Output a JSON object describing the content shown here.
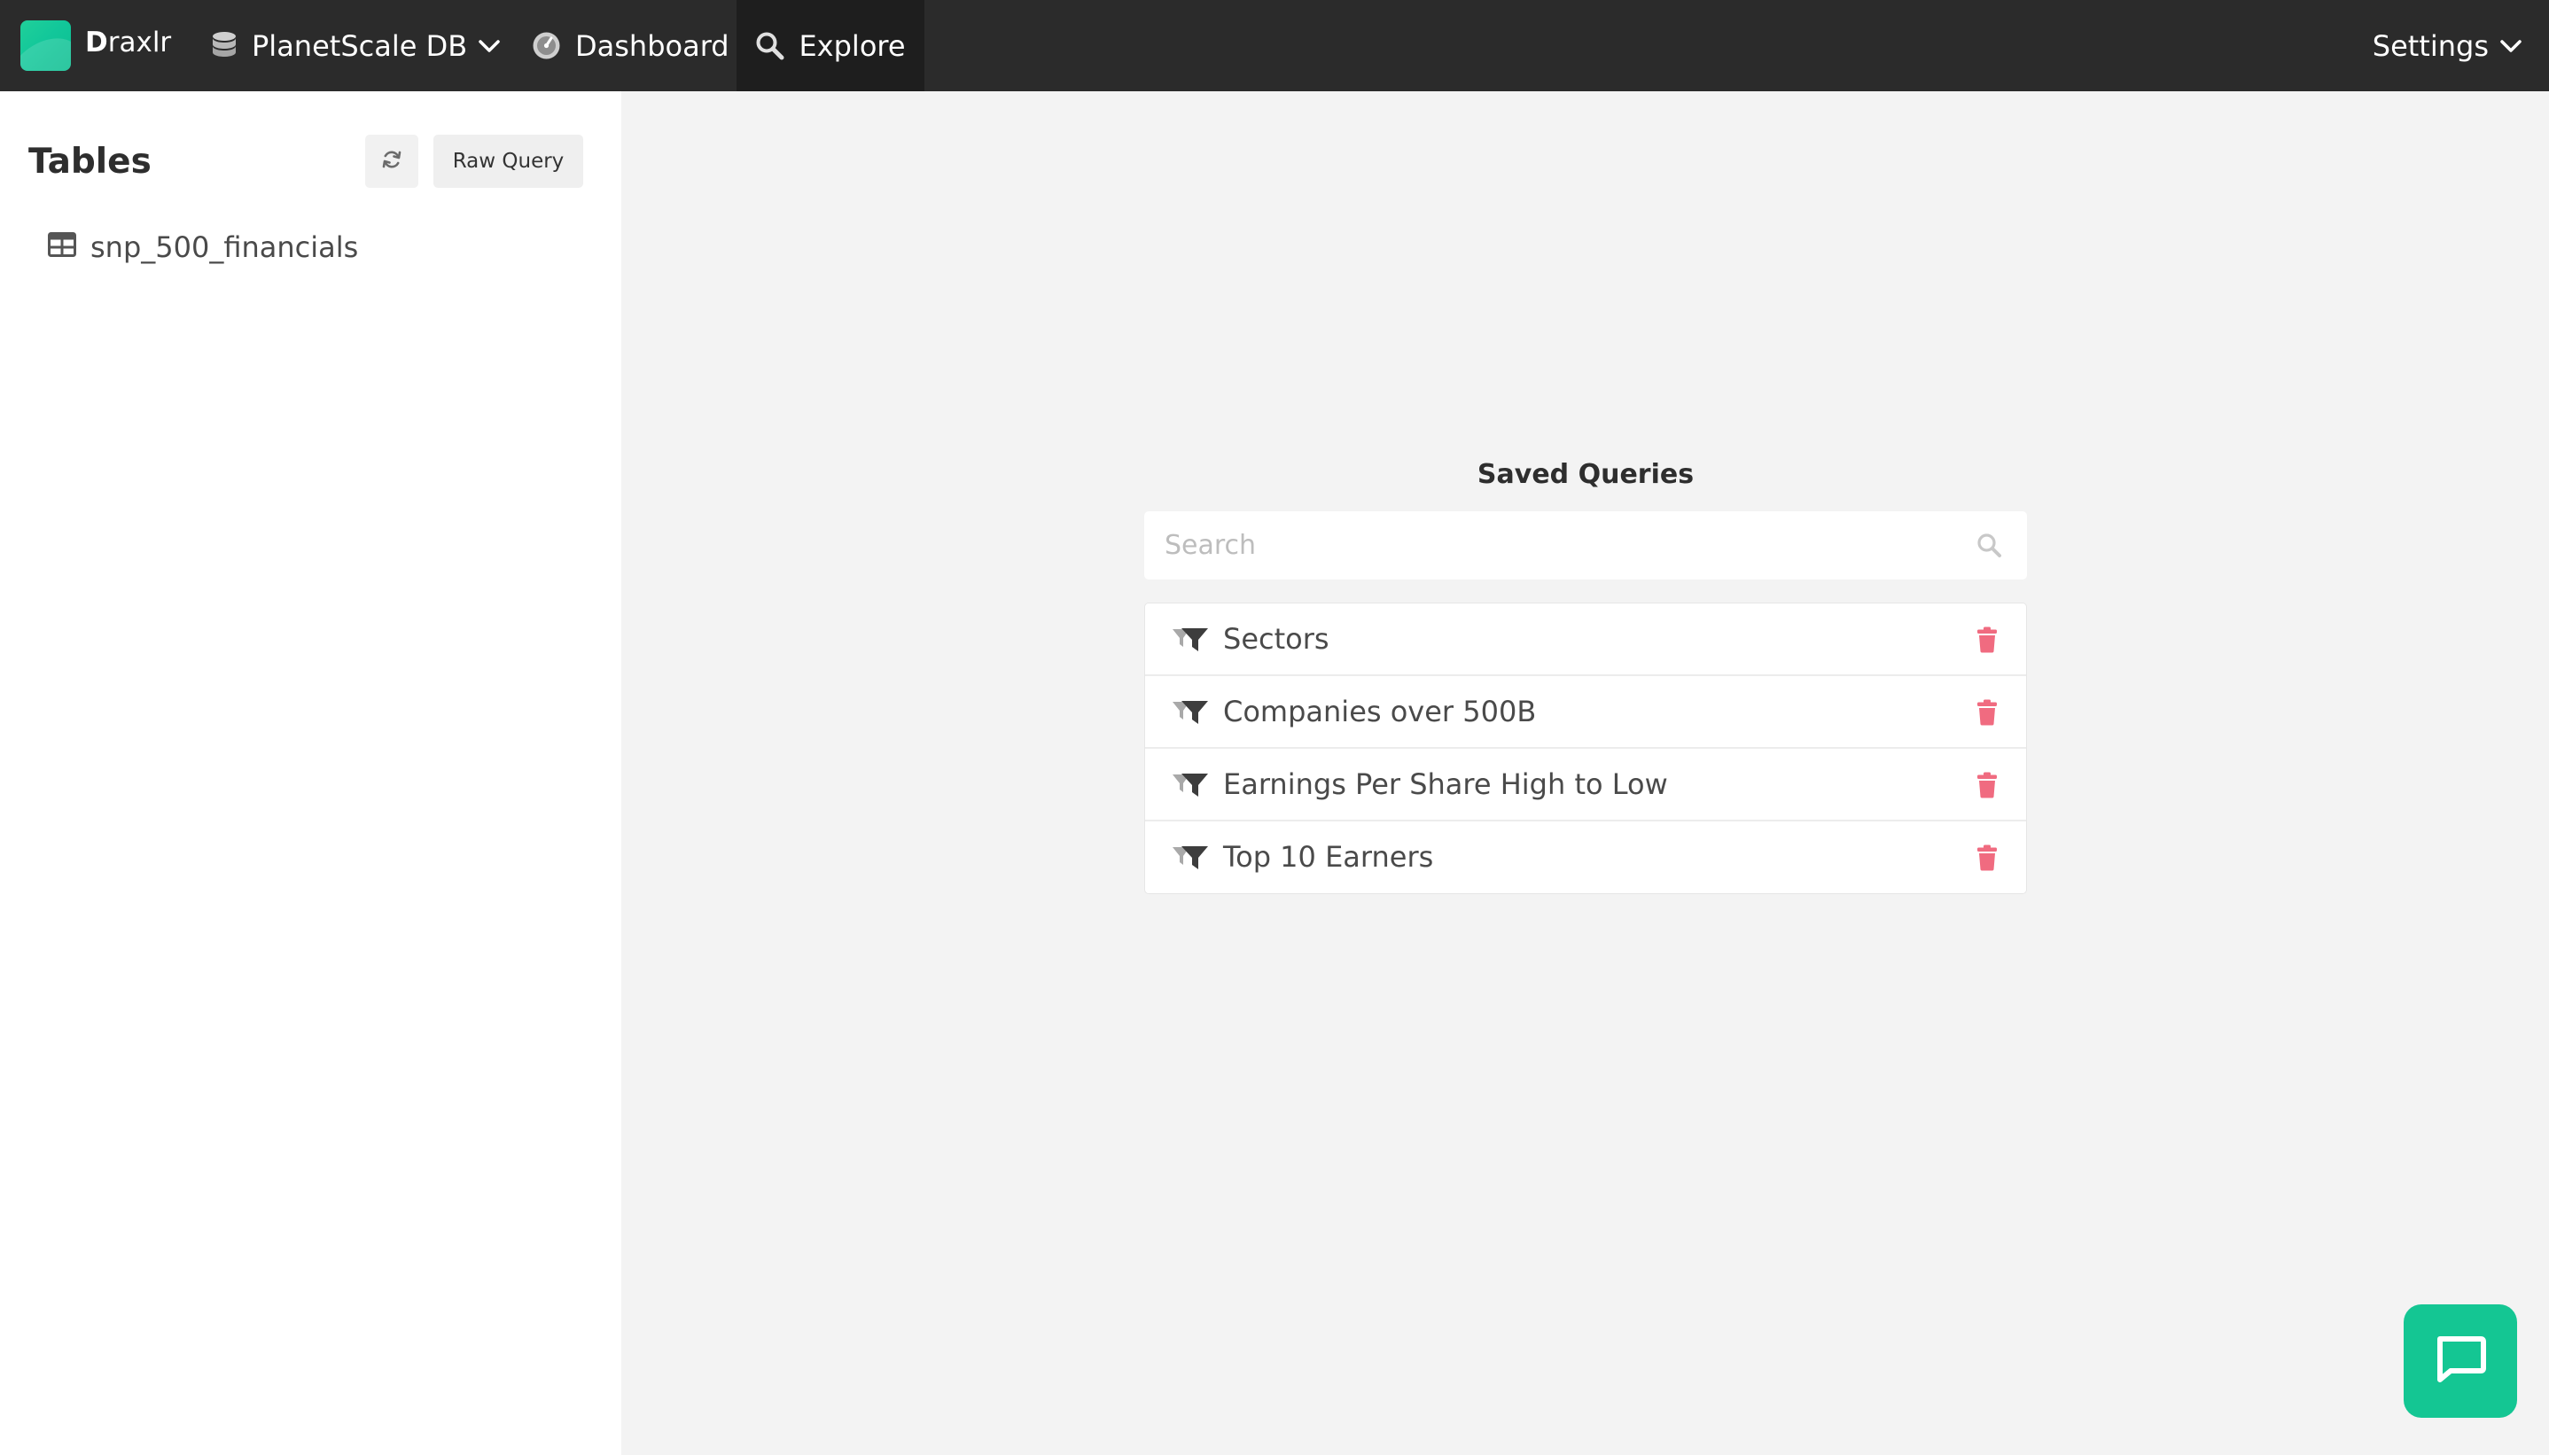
{
  "topbar": {
    "brand_first": "D",
    "brand_rest": "raxlr",
    "db_label": "PlanetScale DB",
    "dashboard_label": "Dashboard",
    "explore_label": "Explore",
    "settings_label": "Settings"
  },
  "sidebar": {
    "title": "Tables",
    "raw_query_label": "Raw Query",
    "tables": [
      "snp_500_financials"
    ]
  },
  "saved_queries": {
    "title": "Saved Queries",
    "search_placeholder": "Search",
    "items": [
      {
        "label": "Sectors"
      },
      {
        "label": "Companies over 500B"
      },
      {
        "label": "Earnings Per Share High to Low"
      },
      {
        "label": "Top 10 Earners"
      }
    ]
  },
  "colors": {
    "topbar_bg": "#2b2b2b",
    "active_nav_bg": "#1e1e1e",
    "brand_accent": "#14c693",
    "delete_icon": "#f06b80"
  },
  "icons": {
    "db": "database-icon",
    "dashboard": "dashboard-gauge-icon",
    "explore": "search-icon",
    "refresh": "refresh-icon",
    "table": "table-icon",
    "query": "filter-icon",
    "delete": "trash-icon",
    "chat": "chat-icon"
  }
}
